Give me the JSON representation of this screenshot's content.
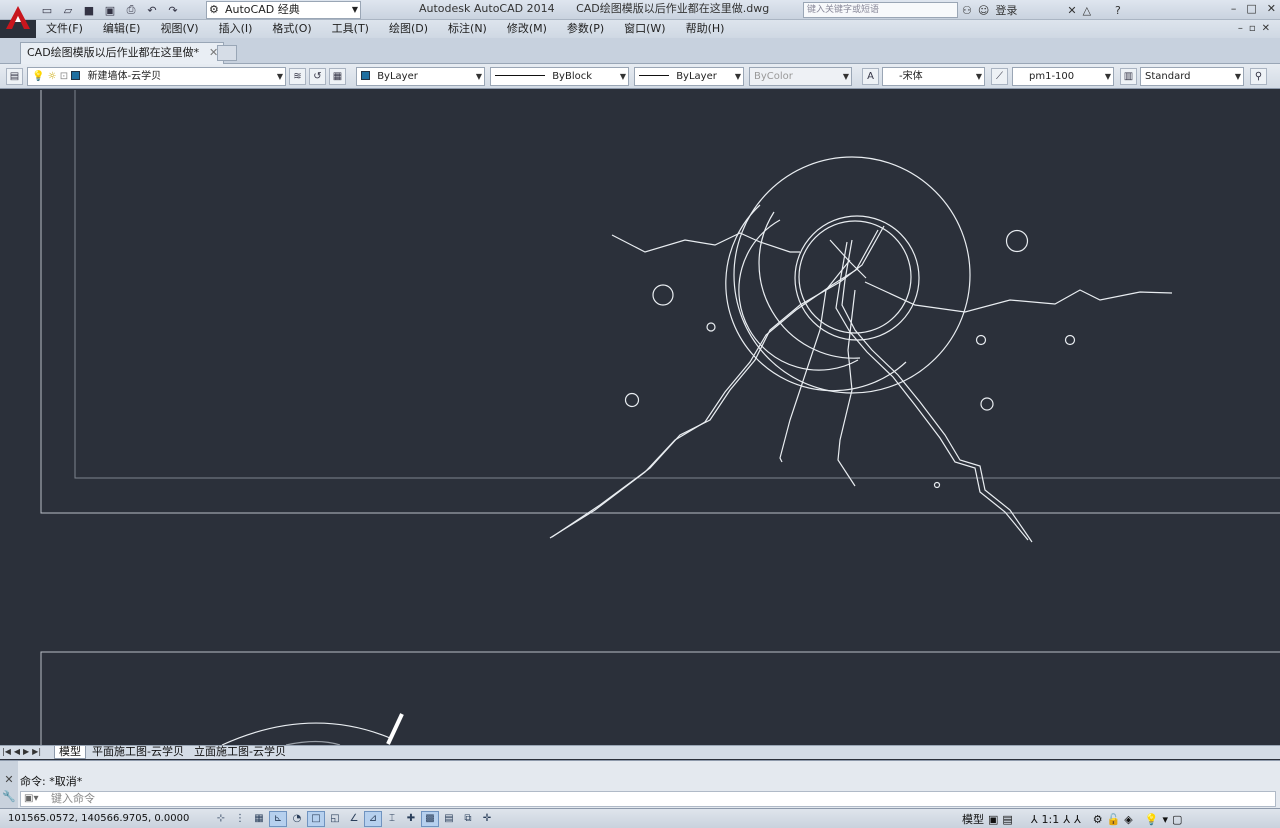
{
  "titlebar": {
    "workspace": "AutoCAD 经典",
    "app_name": "Autodesk AutoCAD 2014",
    "file_name": "CAD绘图模版以后作业都在这里做.dwg",
    "search_placeholder": "键入关键字或短语",
    "login_label": "登录"
  },
  "menu": {
    "items": [
      "文件(F)",
      "编辑(E)",
      "视图(V)",
      "插入(I)",
      "格式(O)",
      "工具(T)",
      "绘图(D)",
      "标注(N)",
      "修改(M)",
      "参数(P)",
      "窗口(W)",
      "帮助(H)"
    ]
  },
  "doc_tab": {
    "label": "CAD绘图模版以后作业都在这里做*"
  },
  "properties": {
    "layer": "新建墙体-云学贝",
    "color": "ByLayer",
    "linetype": "ByBlock",
    "lineweight": "ByLayer",
    "plotstyle": "ByColor",
    "text_style": "-宋体",
    "dim_style": "pm1-100",
    "table_style": "Standard"
  },
  "layout_tabs": [
    "模型",
    "平面施工图-云学贝",
    "立面施工图-云学贝"
  ],
  "command": {
    "history": "命令: *取消*",
    "placeholder": "键入命令"
  },
  "status": {
    "coordinates": "101565.0572,  140566.9705,  0.0000",
    "model_label": "模型",
    "scale": "1:1"
  },
  "colors": {
    "canvas_bg": "#2b303a",
    "drawing_lines": "#e8ecf0",
    "chrome": "#d4dce6"
  }
}
